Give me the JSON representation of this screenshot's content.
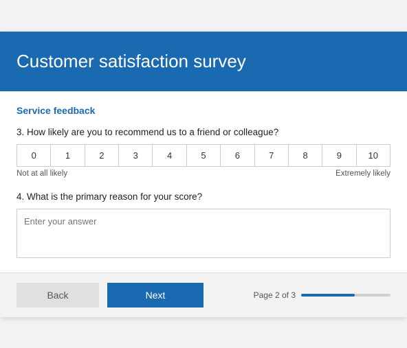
{
  "header": {
    "title": "Customer satisfaction survey"
  },
  "section": {
    "label": "Service feedback"
  },
  "questions": [
    {
      "number": "3.",
      "text": "How likely are you to recommend us to a friend or colleague?",
      "type": "likert",
      "options": [
        "0",
        "1",
        "2",
        "3",
        "4",
        "5",
        "6",
        "7",
        "8",
        "9",
        "10"
      ],
      "label_left": "Not at all likely",
      "label_right": "Extremely likely"
    },
    {
      "number": "4.",
      "text": "What is the primary reason for your score?",
      "type": "textarea",
      "placeholder": "Enter your answer"
    }
  ],
  "footer": {
    "back_label": "Back",
    "next_label": "Next",
    "page_label": "Page 2 of 3",
    "progress_percent": 60
  }
}
